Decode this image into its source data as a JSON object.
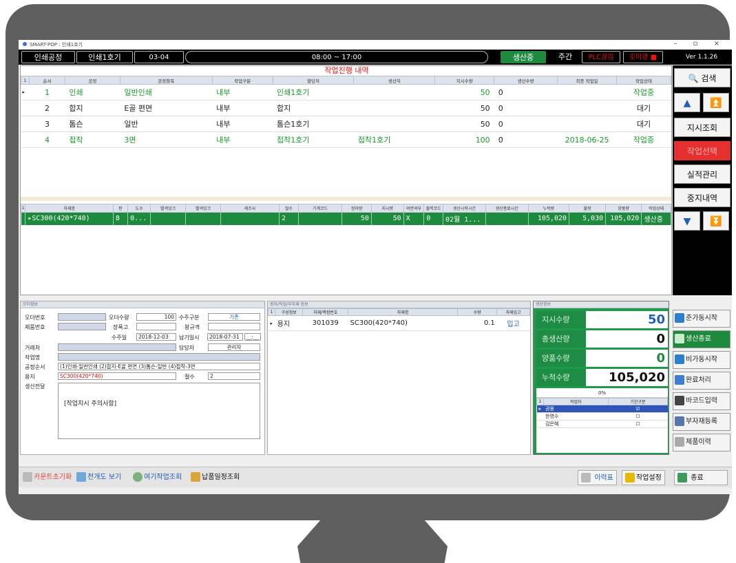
{
  "window": {
    "title": "SMART-POP : 인쇄1호기",
    "controls": "–  ▫  ×"
  },
  "topbar": {
    "process": "인쇄공정",
    "machine": "인쇄1호기",
    "date": "03-04",
    "time_range": "08:00 ~ 17:00",
    "status": "생산중",
    "shift": "주간",
    "plc": "PLC끊김",
    "light": "조미광 ■",
    "version": "Ver 1.1.26"
  },
  "progress": {
    "title": "작업진행 내역",
    "columns": [
      "순서",
      "공정",
      "공정항목",
      "작업구분",
      "할당처",
      "생산처",
      "지시수량",
      "생산수량",
      "최종 작업일",
      "작업상태"
    ],
    "rows": [
      {
        "seq": "1",
        "proc": "인쇄",
        "item": "일반인쇄",
        "type": "내부",
        "assign": "인쇄1호기",
        "prod": "",
        "qty": "50",
        "done": "0",
        "date": "",
        "state": "작업중",
        "green": true,
        "mark": "▸"
      },
      {
        "seq": "2",
        "proc": "합지",
        "item": "E골 편면",
        "type": "내부",
        "assign": "합지",
        "prod": "",
        "qty": "50",
        "done": "0",
        "date": "",
        "state": "대기",
        "green": false,
        "mark": ""
      },
      {
        "seq": "3",
        "proc": "톰슨",
        "item": "일반",
        "type": "내부",
        "assign": "톰슨1호기",
        "prod": "",
        "qty": "50",
        "done": "0",
        "date": "",
        "state": "대기",
        "green": false,
        "mark": ""
      },
      {
        "seq": "4",
        "proc": "접착",
        "item": "3면",
        "type": "내부",
        "assign": "접착1호기",
        "prod": "접착1호기",
        "qty": "100",
        "done": "0",
        "date": "2018-06-25",
        "state": "작업중",
        "green": true,
        "mark": ""
      }
    ]
  },
  "material_grid": {
    "columns": [
      "자재명",
      "판",
      "도수",
      "별색잉크",
      "별색잉크",
      "제조사",
      "절수",
      "기계코드",
      "정미량",
      "지시량",
      "여분여부",
      "출력코드",
      "생산시작시간",
      "생산종료시간",
      "누적량",
      "불량",
      "양품량",
      "작업상태"
    ],
    "row": [
      "▸SC300(420*740)",
      "8",
      "0...",
      "",
      "",
      "",
      "2",
      "",
      "50",
      "50",
      "X",
      "0",
      "02월 1...",
      "",
      "105,020",
      "5,030",
      "105,020",
      "생산중"
    ]
  },
  "nav": {
    "search": "검색",
    "order_lookup": "지시조회",
    "work_select": "작업선택",
    "result_mgmt": "실적관리",
    "stop_history": "중지내역",
    "up": "▲",
    "top": "⏫",
    "down": "▼",
    "bottom": "⏬"
  },
  "order_info": {
    "header": "오더정보",
    "order_no_label": "오더번호",
    "order_qty_label": "오더수량",
    "order_qty": "100",
    "order_type_label": "수주구분",
    "order_type": "기존",
    "product_no_label": "제품번호",
    "spec_label": "장폭고",
    "size_label": "왕규격",
    "order_date_label": "수주일",
    "order_date": "2018-12-03",
    "due_label": "납기일시",
    "due": "2018-07-31",
    "due_extra": "__:__",
    "client_label": "거래처",
    "manager_label": "담당자",
    "manager": "관리자",
    "job_label": "작업명",
    "route_label": "공정순서",
    "route": "(1)인쇄-일반인쇄 (2)합지-E골 편면 (3)톰슨-일반 (4)접착-3면",
    "paper_label": "용지",
    "paper": "SC300(420*740)",
    "cut_label": "절수",
    "cut": "2",
    "note_label": "생산전달",
    "note": "[작업지시 주의사항]"
  },
  "material_info": {
    "header": "원자/작업/부자재 정보",
    "columns": [
      "구성정보",
      "자재/맥컴번호",
      "자재명",
      "수량",
      "자재입고"
    ],
    "row": {
      "kind": "용지",
      "code": "301039",
      "name": "SC300(420*740)",
      "qty": "0.1",
      "status": "입고"
    }
  },
  "production": {
    "header": "생산정보",
    "labels": [
      "지시수량",
      "총생산량",
      "양품수량",
      "누적수량"
    ],
    "values": [
      "50",
      "0",
      "0",
      "105,020"
    ],
    "percent": "0%",
    "worker_columns": [
      "작업자",
      "기간구분"
    ],
    "workers": [
      {
        "name": "권용",
        "check": "☑",
        "selected": true
      },
      {
        "name": "한영수",
        "check": "☐",
        "selected": false
      },
      {
        "name": "김은혜",
        "check": "☐",
        "selected": false
      }
    ]
  },
  "actions": [
    "준가동시작",
    "생산종료",
    "비가동시작",
    "완료처리",
    "바코드입력",
    "부자재등록",
    "제품이력"
  ],
  "bottom": {
    "left": [
      "카운트초기화",
      "전개도 보기",
      "여기작업조회",
      "납품일정조회"
    ],
    "right": [
      "이력표",
      "작업설정",
      "종료"
    ]
  },
  "colors": {
    "accent_green": "#1e8a3e",
    "alert_red": "#e11",
    "nav_blue": "#1f5fb8"
  }
}
